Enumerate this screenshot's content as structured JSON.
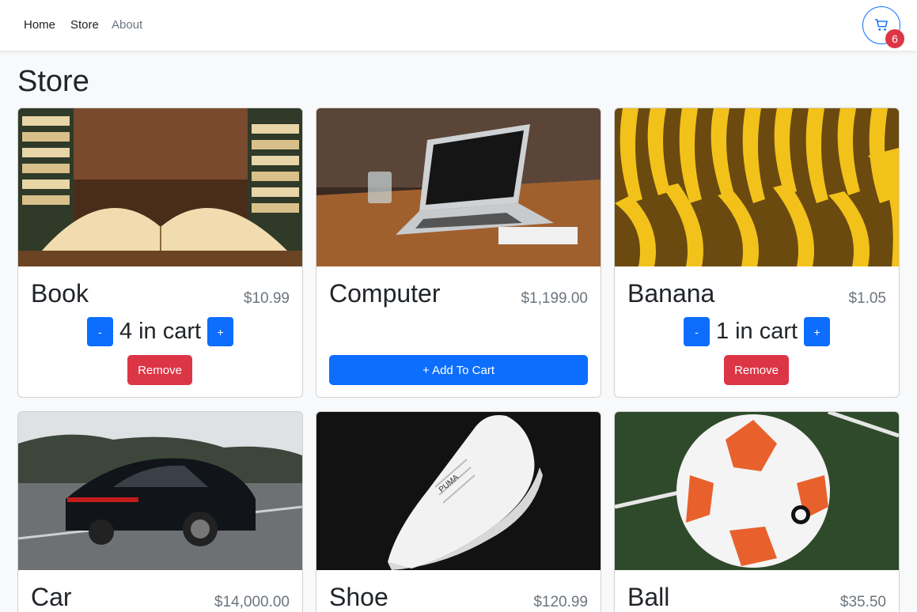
{
  "nav": {
    "links": [
      "Home",
      "Store",
      "About"
    ],
    "cart_count": "6",
    "cart_icon": "shopping-cart-icon",
    "badge_color": "#dc3545",
    "accent_color": "#0d6efd"
  },
  "page": {
    "title": "Store"
  },
  "ui": {
    "in_cart": "in cart",
    "remove_label": "Remove",
    "add_label": "+ Add To Cart",
    "minus_label": "-",
    "plus_label": "+"
  },
  "products": [
    {
      "name": "Book",
      "price": "$10.99",
      "qty": "4",
      "image": "open book with stacks of books"
    },
    {
      "name": "Computer",
      "price": "$1,199.00",
      "qty": "0",
      "image": "laptop on wooden desk"
    },
    {
      "name": "Banana",
      "price": "$1.05",
      "qty": "1",
      "image": "bunches of bananas"
    },
    {
      "name": "Car",
      "price": "$14,000.00",
      "qty": "0",
      "image": "black sports car on road"
    },
    {
      "name": "Shoe",
      "price": "$120.99",
      "qty": "0",
      "image": "white sneaker on black background"
    },
    {
      "name": "Ball",
      "price": "$35.50",
      "qty": "0",
      "image": "soccer ball on grass"
    }
  ]
}
